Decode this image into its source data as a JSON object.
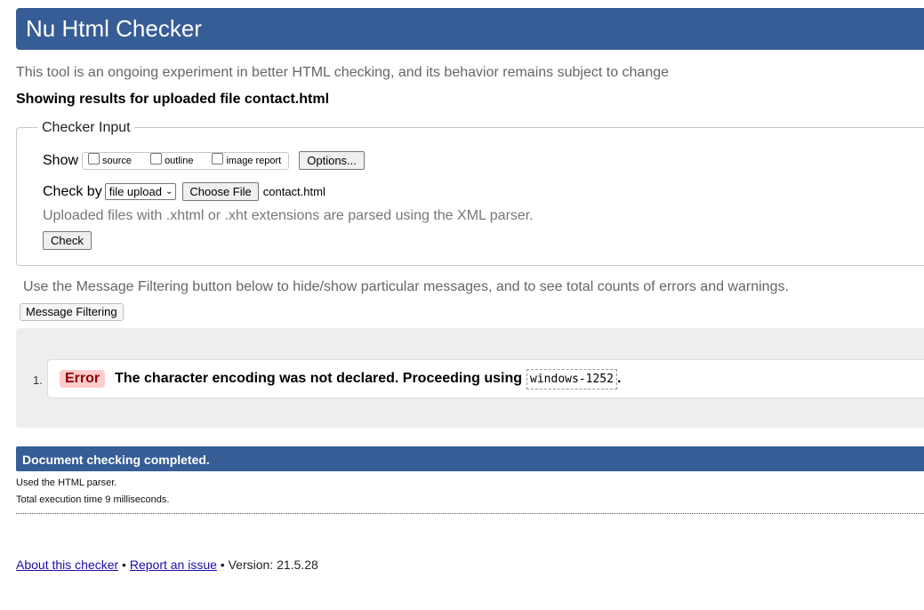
{
  "header": {
    "title": "Nu Html Checker"
  },
  "intro": "This tool is an ongoing experiment in better HTML checking, and its behavior remains subject to change",
  "showing": "Showing results for uploaded file contact.html",
  "checker_input": {
    "legend": "Checker Input",
    "show_label": "Show",
    "show_options": [
      "source",
      "outline",
      "image report"
    ],
    "options_button": "Options...",
    "check_by_label": "Check by",
    "check_by_selected": "file upload",
    "choose_file_button": "Choose File",
    "file_name": "contact.html",
    "xml_note": "Uploaded files with .xhtml or .xht extensions are parsed using the XML parser.",
    "check_button": "Check"
  },
  "filter": {
    "note": "Use the Message Filtering button below to hide/show particular messages, and to see total counts of errors and warnings.",
    "button": "Message Filtering"
  },
  "messages": [
    {
      "number": "1.",
      "type": "Error",
      "text": "The character encoding was not declared. Proceeding using",
      "code": "windows-1252",
      "end": "."
    }
  ],
  "completion": {
    "title": "Document checking completed.",
    "parser": "Used the HTML parser.",
    "time": "Total execution time 9 milliseconds."
  },
  "footer": {
    "about": "About this checker",
    "separator1": " • ",
    "report": "Report an issue",
    "separator2": " • ",
    "version": "Version: 21.5.28"
  },
  "colors": {
    "header_bg": "#365d95",
    "error_badge_bg": "#ffcccc",
    "error_badge_text": "#8c0000",
    "results_bg": "#eeeeee"
  }
}
